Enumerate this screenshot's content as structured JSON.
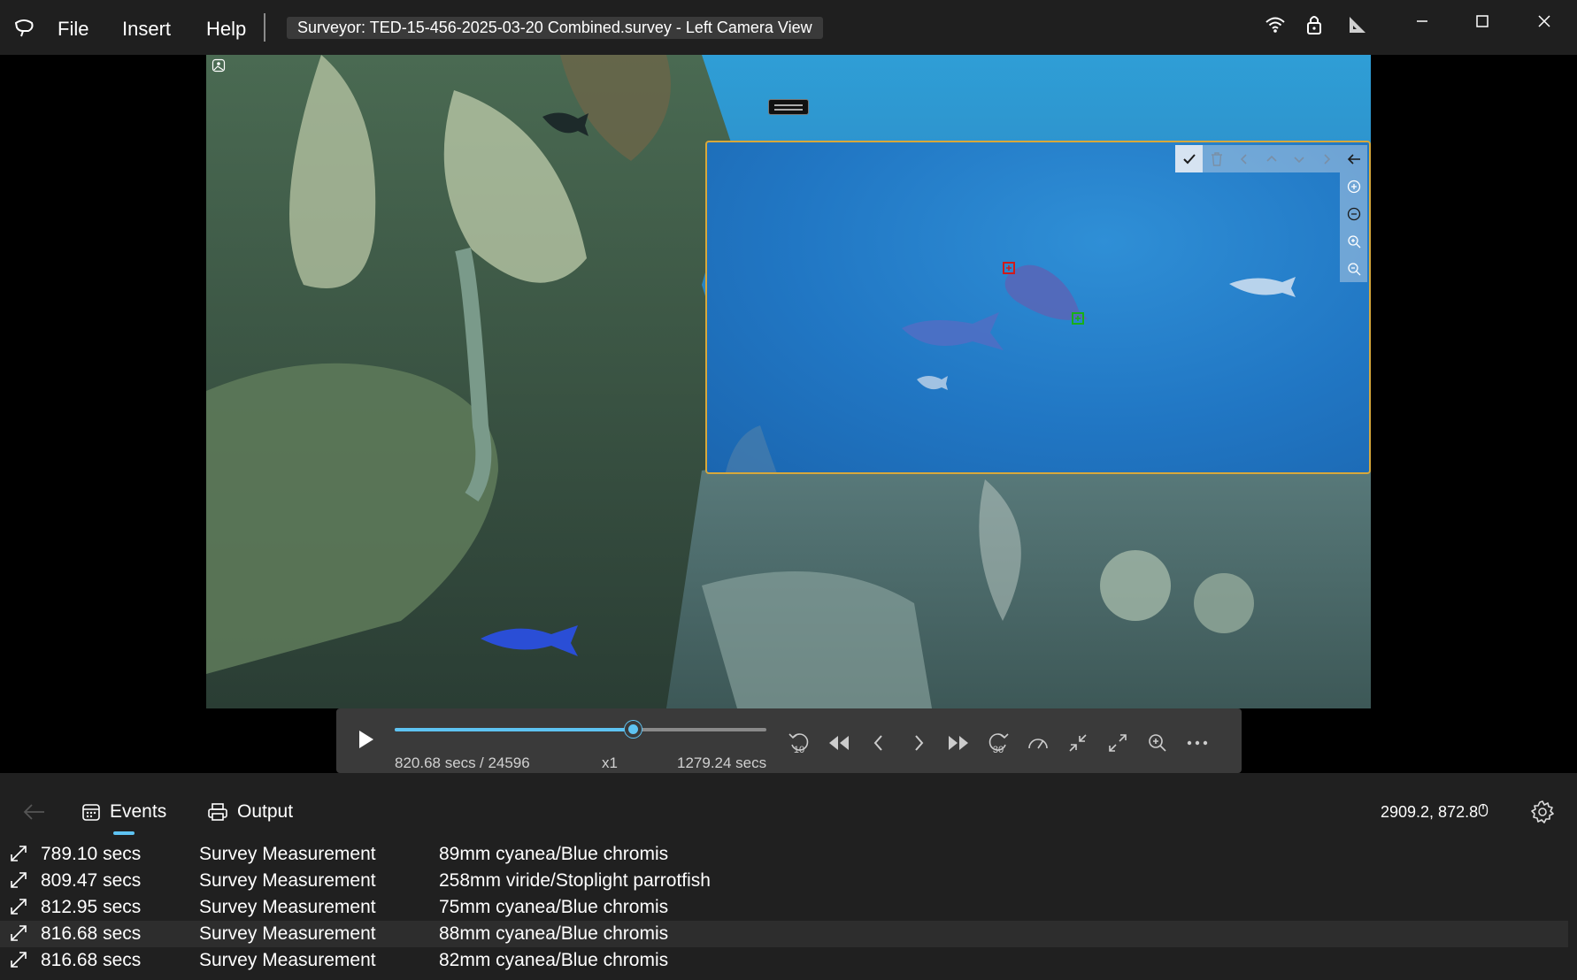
{
  "menu": {
    "file": "File",
    "insert": "Insert",
    "help": "Help"
  },
  "window": {
    "title": "Surveyor: TED-15-456-2025-03-20 Combined.survey - Left Camera View",
    "icons": [
      "wifi-icon",
      "lock-icon",
      "ruler-triangle-icon"
    ],
    "controls": [
      "minimize-icon",
      "maximize-icon",
      "close-icon"
    ]
  },
  "zoom_panel": {
    "toolbar": [
      "check-icon",
      "trash-icon",
      "chevron-left-icon",
      "chevron-up-icon",
      "chevron-down-icon",
      "chevron-right-icon",
      "arrow-left-icon"
    ],
    "side": [
      "add-circle-icon",
      "remove-circle-icon",
      "zoom-in-icon",
      "zoom-out-icon"
    ],
    "accent": "#d7a83b"
  },
  "playback": {
    "current": "820.68 secs",
    "frames": " / 24596",
    "speed": "x1",
    "duration": "1279.24 secs",
    "progress": 0.6416,
    "accent": "#5ec3f2",
    "rewind_label": "10",
    "forward_label": "30"
  },
  "tabs": {
    "events": "Events",
    "output": "Output"
  },
  "status": {
    "coords": "2909.2, 872.8"
  },
  "events": [
    {
      "time": "789.10 secs",
      "type": "Survey Measurement",
      "desc": "89mm cyanea/Blue chromis"
    },
    {
      "time": "809.47 secs",
      "type": "Survey Measurement",
      "desc": "258mm viride/Stoplight parrotfish"
    },
    {
      "time": "812.95 secs",
      "type": "Survey Measurement",
      "desc": "75mm cyanea/Blue chromis"
    },
    {
      "time": "816.68 secs",
      "type": "Survey Measurement",
      "desc": "88mm cyanea/Blue chromis"
    },
    {
      "time": "816.68 secs",
      "type": "Survey Measurement",
      "desc": "82mm cyanea/Blue chromis"
    }
  ]
}
